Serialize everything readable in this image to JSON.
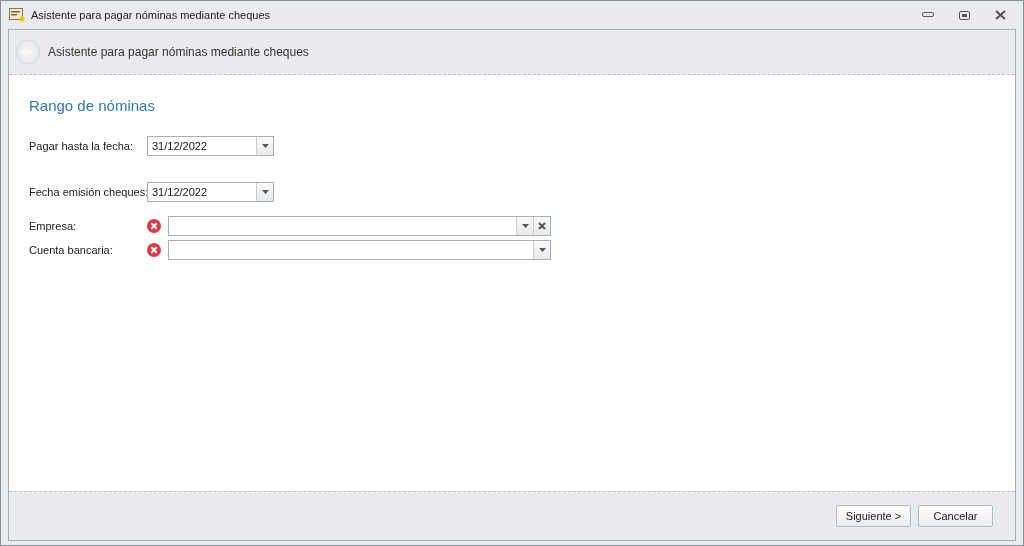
{
  "window": {
    "title": "Asistente para pagar nóminas mediante cheques"
  },
  "header": {
    "title": "Asistente para pagar nóminas mediante cheques"
  },
  "section_title": "Rango de nóminas",
  "fields": [
    {
      "kind": "date",
      "label": "Pagar hasta la fecha:",
      "value": "31/12/2022"
    },
    {
      "kind": "date",
      "label": "Fecha emisión cheques:",
      "value": "31/12/2022"
    },
    {
      "kind": "lookup",
      "label": "Empresa:",
      "error": true,
      "clearable": true
    },
    {
      "kind": "lookup",
      "label": "Cuenta bancaria:",
      "error": true,
      "clearable": false
    }
  ],
  "buttons": [
    {
      "label": "Siguiente >"
    },
    {
      "label": "Cancelar"
    }
  ]
}
